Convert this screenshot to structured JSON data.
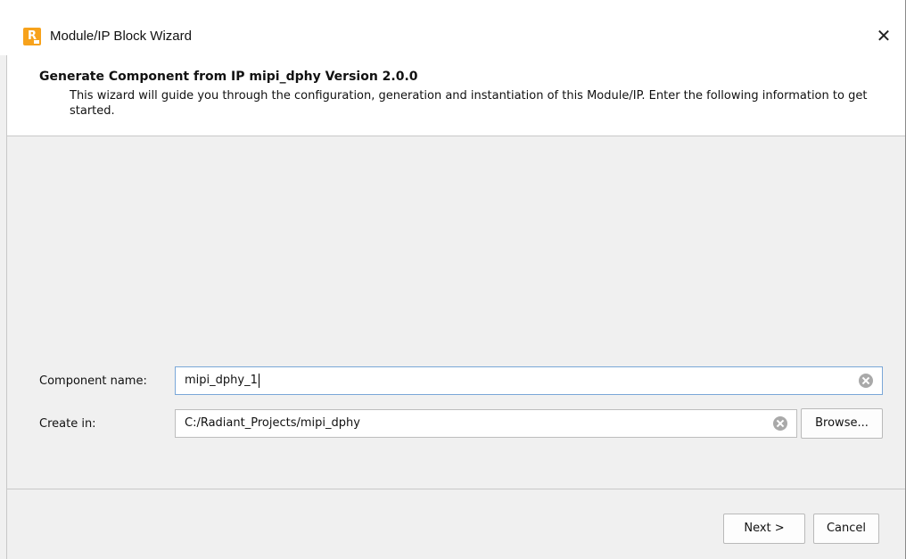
{
  "window": {
    "title": "Module/IP Block Wizard",
    "icon": "radiant-app-icon",
    "icon_letter": "R",
    "close_glyph": "✕"
  },
  "header": {
    "title": "Generate Component from IP mipi_dphy Version 2.0.0",
    "description": "This wizard will guide you through the configuration, generation and instantiation of this Module/IP. Enter the following information to get started."
  },
  "form": {
    "component_name_label": "Component name:",
    "component_name_value": "mipi_dphy_1",
    "create_in_label": "Create in:",
    "create_in_value": "C:/Radiant_Projects/mipi_dphy",
    "browse_label": "Browse..."
  },
  "footer": {
    "next_label": "Next >",
    "cancel_label": "Cancel"
  },
  "colors": {
    "accent_icon": "#f7a21b",
    "focus_border": "#7aa7d8"
  }
}
